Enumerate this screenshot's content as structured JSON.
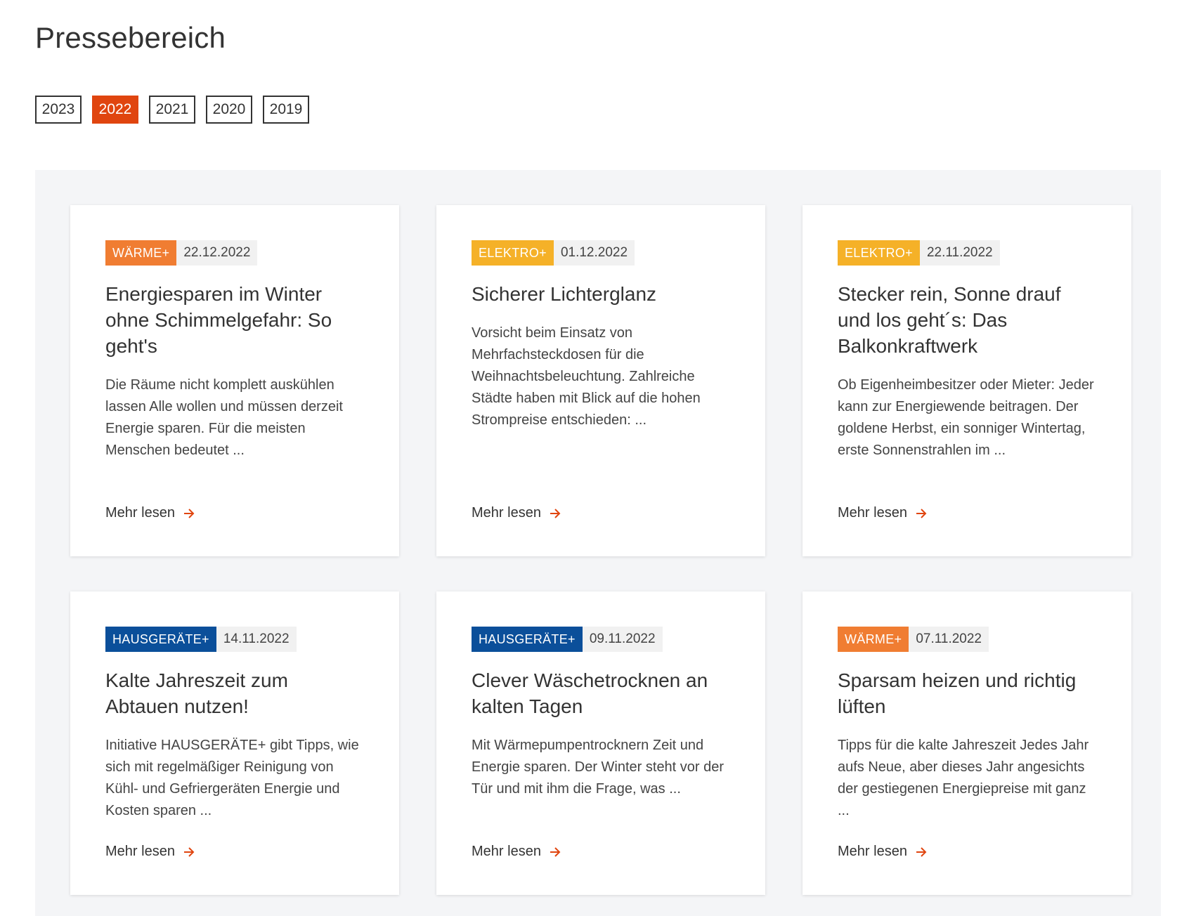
{
  "page": {
    "title": "Pressebereich"
  },
  "colors": {
    "accent": "#e0450f",
    "waerme": "#f07d32",
    "elektro": "#f5b128",
    "hausgeraete": "#0b4f9a",
    "section_bg": "#f4f5f7"
  },
  "year_tabs": [
    {
      "label": "2023",
      "active": false
    },
    {
      "label": "2022",
      "active": true
    },
    {
      "label": "2021",
      "active": false
    },
    {
      "label": "2020",
      "active": false
    },
    {
      "label": "2019",
      "active": false
    }
  ],
  "cards": [
    {
      "tag": "WÄRME+",
      "tag_color": "#f07d32",
      "date": "22.12.2022",
      "title": "Energiesparen im Winter ohne Schimmelgefahr: So geht's",
      "text": "Die Räume nicht komplett auskühlen lassen Alle wollen und müssen derzeit Energie sparen. Für die meisten Menschen bedeutet  ...",
      "link": "Mehr lesen",
      "link_icon": "arrow-right-icon"
    },
    {
      "tag": "ELEKTRO+",
      "tag_color": "#f5b128",
      "date": "01.12.2022",
      "title": "Sicherer Lichterglanz",
      "text": "Vorsicht beim Einsatz von Mehrfachsteckdosen für die Weihnachtsbeleuchtung. Zahlreiche Städte haben mit Blick auf die hohen Strompreise entschieden:  ...",
      "link": "Mehr lesen",
      "link_icon": "arrow-right-icon"
    },
    {
      "tag": "ELEKTRO+",
      "tag_color": "#f5b128",
      "date": "22.11.2022",
      "title": "Stecker rein, Sonne drauf und los geht´s: Das Balkonkraftwerk",
      "text": "Ob Eigenheimbesitzer oder Mieter: Jeder kann zur Energiewende beitragen. Der goldene Herbst, ein sonniger Wintertag, erste Sonnenstrahlen im  ...",
      "link": "Mehr lesen",
      "link_icon": "arrow-right-icon"
    },
    {
      "tag": "HAUSGERÄTE+",
      "tag_color": "#0b4f9a",
      "date": "14.11.2022",
      "title": "Kalte Jahreszeit zum Abtauen nutzen!",
      "text": "Initiative HAUSGERÄTE+ gibt Tipps, wie sich mit regelmäßiger Reinigung von Kühl- und Gefriergeräten Energie und Kosten sparen  ...",
      "link": "Mehr lesen",
      "link_icon": "arrow-right-icon"
    },
    {
      "tag": "HAUSGERÄTE+",
      "tag_color": "#0b4f9a",
      "date": "09.11.2022",
      "title": "Clever Wäschetrocknen an kalten Tagen",
      "text": "Mit Wärmepumpentrocknern Zeit und Energie sparen. Der Winter steht vor der Tür und mit ihm die Frage, was  ...",
      "link": "Mehr lesen",
      "link_icon": "arrow-right-icon"
    },
    {
      "tag": "WÄRME+",
      "tag_color": "#f07d32",
      "date": "07.11.2022",
      "title": "Sparsam heizen und richtig lüften",
      "text": "Tipps für die kalte Jahreszeit Jedes Jahr aufs Neue, aber dieses Jahr angesichts der gestiegenen Energiepreise mit ganz  ...",
      "link": "Mehr lesen",
      "link_icon": "arrow-right-icon"
    }
  ]
}
